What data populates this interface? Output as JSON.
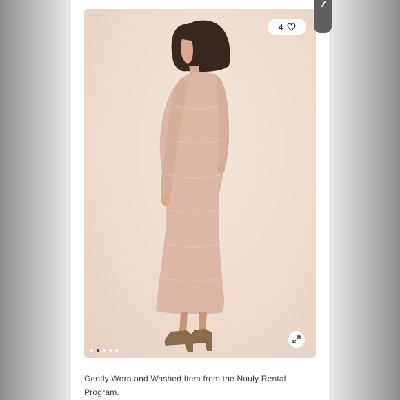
{
  "listing": {
    "like_count": "4",
    "icons": {
      "like": "heart-icon",
      "expand": "expand-arrows-icon",
      "back": "chevron-left-icon"
    },
    "carousel": {
      "total_slides": 5,
      "active_index": 1
    },
    "description": "Gently Worn and Washed Item from the Nuuly Rental Program."
  },
  "colors": {
    "photo_background": "#eedccf",
    "dress": "#dcb8a4",
    "text": "#3a3a3a"
  }
}
